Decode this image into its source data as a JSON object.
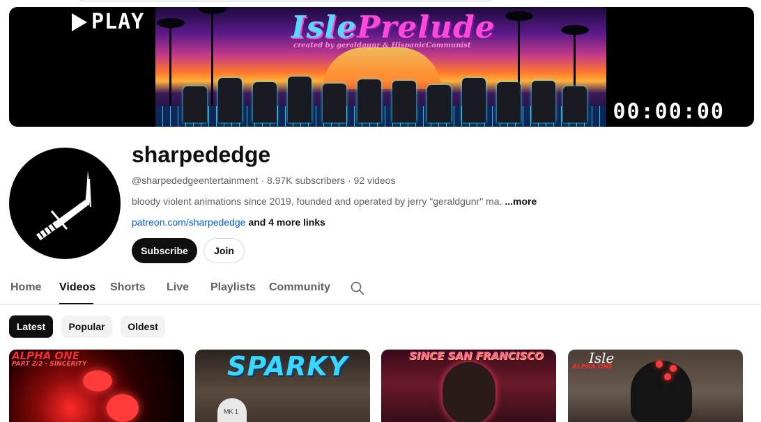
{
  "banner": {
    "play_label": "PLAY",
    "title_part1": "Isle",
    "title_part2": "Prelude",
    "credit": "created by geraldgunr & HispanicCommunist",
    "timer": "00:00:00"
  },
  "channel": {
    "name": "sharpededge",
    "handle": "@sharpededgeentertainment",
    "subscribers": "8.97K subscribers",
    "video_count": "92 videos",
    "separator": "·",
    "description": "bloody violent animations since 2019, founded and operated by jerry \"geraldgunr\" ma.",
    "more_label": "...more",
    "link": "patreon.com/sharpededge",
    "more_links": "and 4 more links"
  },
  "actions": {
    "subscribe_label": "Subscribe",
    "join_label": "Join"
  },
  "tabs": [
    {
      "label": "Home"
    },
    {
      "label": "Videos"
    },
    {
      "label": "Shorts"
    },
    {
      "label": "Live"
    },
    {
      "label": "Playlists"
    },
    {
      "label": "Community"
    }
  ],
  "active_tab": "Videos",
  "filters": [
    {
      "label": "Latest"
    },
    {
      "label": "Popular"
    },
    {
      "label": "Oldest"
    }
  ],
  "active_filter": "Latest",
  "thumbnails": [
    {
      "title": "ALPHA ONE",
      "subtitle": "PART 2/2 - SINCERITY"
    },
    {
      "title": "SPARKY",
      "badge": "MK 1"
    },
    {
      "title": "SINCE SAN FRANCISCO"
    },
    {
      "title": "Isle",
      "subtitle": "ALPHA ONE"
    }
  ],
  "colors": {
    "text_primary": "#0f0f0f",
    "text_secondary": "#606060",
    "link": "#065fd4",
    "chip_bg": "#f2f2f2"
  },
  "icons": {
    "avatar": "knife-icon",
    "search": "search-icon",
    "play": "play-icon"
  }
}
